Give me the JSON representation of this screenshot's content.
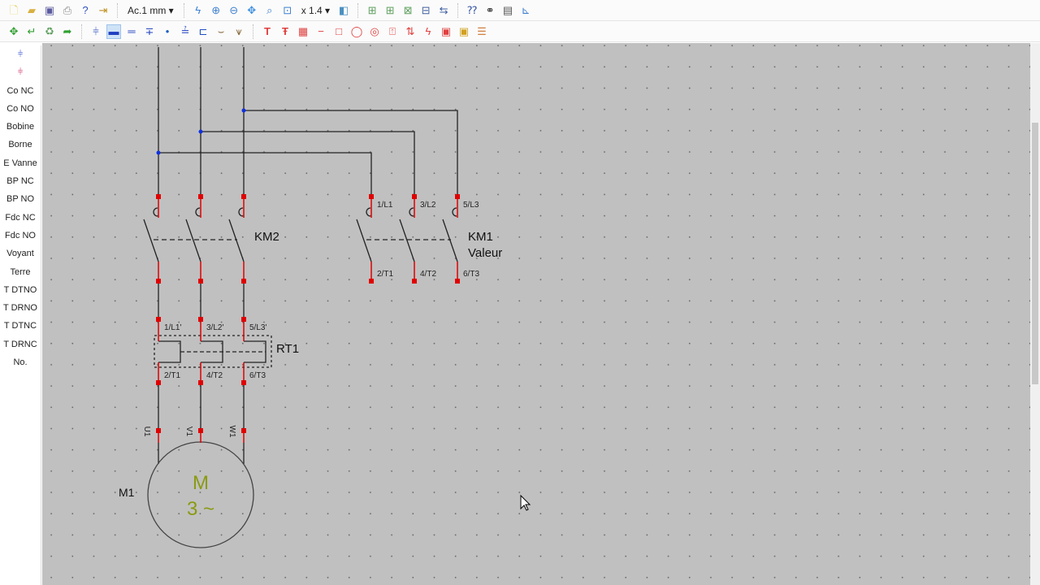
{
  "toolbar1": {
    "icons": [
      "new-file",
      "open-folder",
      "save",
      "print",
      "help",
      "exit"
    ],
    "grid_select": "Ac.1 mm ▾",
    "zoom_icons": [
      "lightning",
      "zoom-in",
      "zoom-out",
      "pan",
      "zoom-window",
      "zoom-fit"
    ],
    "zoom_select": "x 1.4 ▾",
    "layers": "layers ▾",
    "tools": [
      "select-x2",
      "add-select",
      "delete-select",
      "group-down",
      "swap",
      "find-help",
      "binoculars",
      "info",
      "coordinates"
    ]
  },
  "toolbar2": {
    "icons": [
      "move",
      "enter",
      "recycle",
      "redo",
      "contact",
      "wire",
      "double-wire",
      "cross-wire",
      "dot",
      "wire-10",
      "terminal",
      "bridge",
      "tilde"
    ],
    "red_icons": [
      "text-T",
      "text-T-label",
      "grid",
      "line",
      "square",
      "circle",
      "ring",
      "fuse",
      "arrow",
      "spark",
      "frame",
      "frame-n",
      "stack"
    ]
  },
  "sidebar": {
    "items": [
      "Co NC",
      "Co NO",
      "Bobine",
      "Borne",
      "E Vanne",
      "BP NC",
      "BP NO",
      "Fdc NC",
      "Fdc NO",
      "Voyant",
      "Terre",
      "T DTNO",
      "T DRNO",
      "T DTNC",
      "T DRNC",
      "No."
    ]
  },
  "schematic": {
    "km2": "KM2",
    "km1": "KM1",
    "km1_value": "Valeur",
    "rt1": "RT1",
    "m1": "M1",
    "motor_m": "M",
    "motor_phase": "3 ~",
    "km1_top": [
      "1/L1",
      "3/L2",
      "5/L3"
    ],
    "km1_bottom": [
      "2/T1",
      "4/T2",
      "6/T3"
    ],
    "rt1_top": [
      "1/L1'",
      "3/L2'",
      "5/L3'"
    ],
    "rt1_bottom": [
      "2/T1",
      "4/T2",
      "6/T3"
    ],
    "motor_terms": [
      "U1",
      "V1",
      "W1"
    ],
    "colors": {
      "wire": "#222222",
      "terminal": "#e00000",
      "junction": "#1030e0",
      "motor_text": "#8a9a10"
    }
  }
}
